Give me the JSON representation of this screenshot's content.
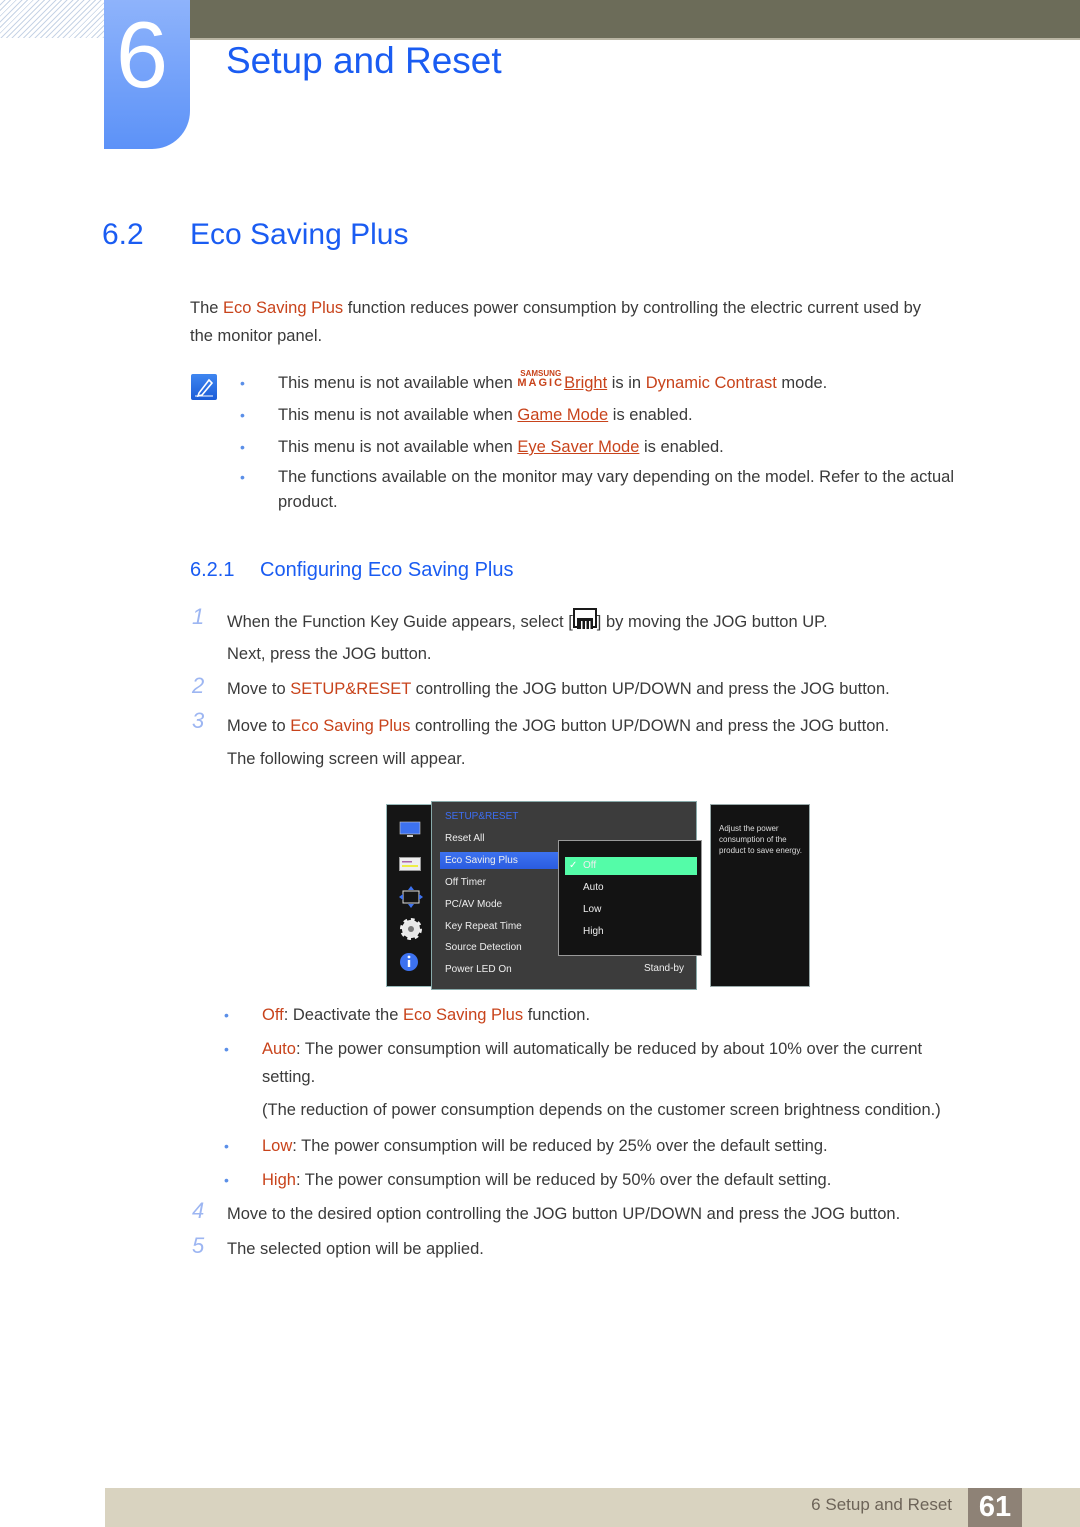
{
  "header": {
    "chapter_number": "6",
    "chapter_title": "Setup and Reset"
  },
  "section": {
    "number": "6.2",
    "title": "Eco Saving Plus",
    "intro_pre": "The ",
    "intro_hl": "Eco Saving Plus",
    "intro_post": " function reduces power consumption by controlling the electric current used by",
    "intro_line2": "the monitor panel."
  },
  "notes": {
    "icon": "note-pencil-icon",
    "n1_pre": "This menu is not available when ",
    "n1_magic_top": "SAMSUNG",
    "n1_magic_bottom": "MAGIC",
    "n1_link": "Bright",
    "n1_mid": " is in ",
    "n1_hl": "Dynamic Contrast",
    "n1_post": " mode.",
    "n2_pre": "This menu is not available when ",
    "n2_link": "Game Mode",
    "n2_post": " is enabled.",
    "n3_pre": "This menu is not available when ",
    "n3_link": "Eye Saver Mode",
    "n3_post": " is enabled.",
    "n4_line1": "The functions available on the monitor may vary depending on the model. Refer to the actual",
    "n4_line2": "product."
  },
  "subsection": {
    "number": "6.2.1",
    "title": "Configuring Eco Saving Plus",
    "steps": [
      {
        "num": "1",
        "pre": "When the Function Key Guide appears, select [",
        "post": "] by moving the JOG button UP.",
        "line2": "Next, press the JOG button."
      },
      {
        "num": "2",
        "pre": "Move to ",
        "hl": "SETUP&RESET",
        "post": " controlling the JOG button UP/DOWN and press the JOG button."
      },
      {
        "num": "3",
        "pre": "Move to ",
        "hl": "Eco Saving Plus",
        "post": " controlling the JOG button UP/DOWN and press the JOG button.",
        "line2": "The following screen will appear."
      },
      {
        "num": "4",
        "text": "Move to the desired option controlling the JOG button UP/DOWN and press the JOG button."
      },
      {
        "num": "5",
        "text": "The selected option will be applied."
      }
    ]
  },
  "osd": {
    "header": "SETUP&RESET",
    "menu_items": [
      "Reset All",
      "Eco Saving Plus",
      "Off Timer",
      "PC/AV Mode",
      "Key Repeat Time",
      "Source Detection",
      "Power LED On"
    ],
    "selected_item": "Eco Saving Plus",
    "power_led_value": "Stand-by",
    "options": [
      "Off",
      "Auto",
      "Low",
      "High"
    ],
    "selected_option": "Off",
    "help_text": "Adjust the power consumption of the product to save energy.",
    "side_icons": [
      "monitor-icon",
      "picture-settings-icon",
      "position-arrows-icon",
      "gear-icon",
      "info-icon"
    ]
  },
  "options_desc": {
    "off_label": "Off",
    "off_pre": ": Deactivate the ",
    "off_hl": "Eco Saving Plus",
    "off_post": " function.",
    "auto_label": "Auto",
    "auto_text": ": The power consumption will automatically be reduced by about 10% over the current",
    "auto_line2": "setting.",
    "auto_note": "(The reduction of power consumption depends on the customer screen brightness condition.)",
    "low_label": "Low",
    "low_text": ": The power consumption will be reduced by 25% over the default setting.",
    "high_label": "High",
    "high_text": ": The power consumption will be reduced by 50% over the default setting."
  },
  "footer": {
    "text": "6 Setup and Reset",
    "page": "61"
  },
  "colors": {
    "title_blue": "#1a5cf2",
    "highlight_orange": "#c8431b",
    "osd_selected_green": "#54fca8",
    "header_bar": "#6c6c59"
  }
}
